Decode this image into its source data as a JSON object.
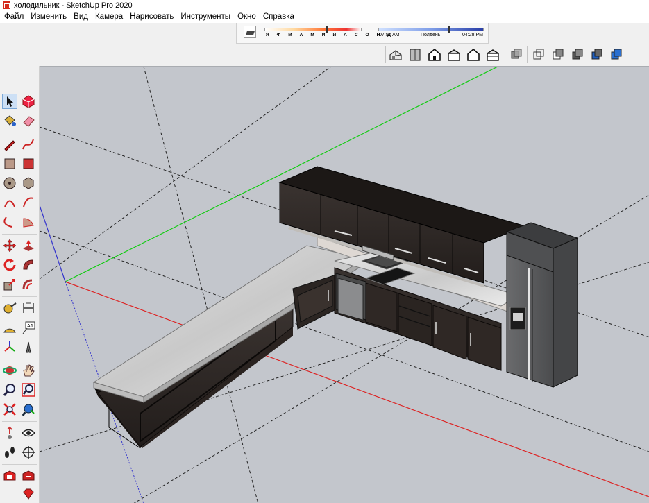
{
  "window": {
    "title": "холодильник - SketchUp Pro 2020"
  },
  "menu": {
    "items": [
      "Файл",
      "Изменить",
      "Вид",
      "Камера",
      "Нарисовать",
      "Инструменты",
      "Окно",
      "Справка"
    ]
  },
  "shadow_settings": {
    "months_label": "Я Ф М А М И И А С О Н Д",
    "time_start": "07:57 AM",
    "time_mid": "Полдень",
    "time_end": "04:28 PM"
  },
  "views_toolbar": {
    "icons": [
      "iso-view-icon",
      "top-view-icon",
      "front-view-icon",
      "right-view-icon",
      "back-view-icon",
      "left-view-icon"
    ],
    "style_icons": [
      "xray-style-icon",
      "wireframe-style-icon",
      "hidden-line-style-icon",
      "shaded-style-icon",
      "shaded-textures-style-icon",
      "monochrome-style-icon"
    ]
  },
  "left_toolbar": {
    "tools": [
      "select-tool-icon",
      "make-component-icon",
      "paint-bucket-icon",
      "eraser-icon",
      "line-tool-icon",
      "freehand-tool-icon",
      "rectangle-tool-icon",
      "rotated-rectangle-icon",
      "circle-tool-icon",
      "polygon-tool-icon",
      "arc-tool-icon",
      "two-point-arc-icon",
      "three-point-arc-icon",
      "pie-tool-icon",
      "move-tool-icon",
      "push-pull-icon",
      "rotate-tool-icon",
      "follow-me-icon",
      "scale-tool-icon",
      "offset-tool-icon",
      "tape-measure-icon",
      "dimension-tool-icon",
      "protractor-icon",
      "text-tool-icon",
      "axes-tool-icon",
      "3d-text-icon",
      "orbit-tool-icon",
      "pan-tool-icon",
      "zoom-tool-icon",
      "zoom-window-icon",
      "zoom-extents-icon",
      "previous-view-icon",
      "position-camera-icon",
      "look-around-icon",
      "walk-tool-icon",
      "section-plane-icon",
      "warehouse-icon",
      "extension-warehouse-icon",
      "ruby-console-icon"
    ]
  },
  "scene": {
    "model_name": "холодильник",
    "colors": {
      "background": "#c3c6cc",
      "red_axis": "#d22",
      "green_axis": "#1c1",
      "blue_axis": "#33c",
      "cabinet_dark": "#2b2522",
      "countertop_marble": "#d9d9d9",
      "fridge_steel": "#5b5c5e"
    }
  }
}
